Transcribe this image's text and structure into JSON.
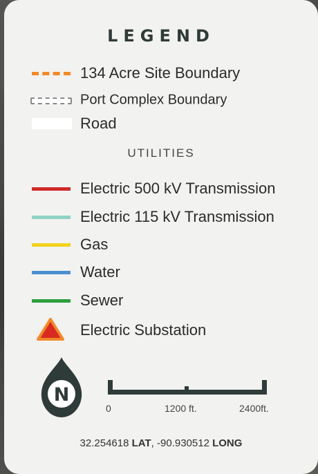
{
  "legend": {
    "title": "LEGEND",
    "items": [
      {
        "label": "134 Acre Site Boundary",
        "color": "#f08a2a"
      },
      {
        "label": "Port Complex Boundary",
        "color": "#8a8a88"
      },
      {
        "label": "Road",
        "color": "#ffffff"
      }
    ],
    "utilities_heading": "UTILITIES",
    "utilities": [
      {
        "label": "Electric 500 kV Transmission",
        "color": "#d02a2a"
      },
      {
        "label": "Electric 115 kV Transmission",
        "color": "#8fd3c4"
      },
      {
        "label": "Gas",
        "color": "#f2d21c"
      },
      {
        "label": "Water",
        "color": "#4a90d0"
      },
      {
        "label": "Sewer",
        "color": "#2e9e3e"
      },
      {
        "label": "Electric Substation",
        "color": "#d82a20",
        "outline": "#f08a2a"
      }
    ]
  },
  "compass": {
    "letter": "N"
  },
  "scale_bar": {
    "ticks": [
      "0",
      "1200",
      "2400"
    ],
    "unit": "ft."
  },
  "coordinates": {
    "lat": "32.254618",
    "lat_label": "LAT",
    "long": "-90.930512",
    "long_label": "LONG"
  }
}
